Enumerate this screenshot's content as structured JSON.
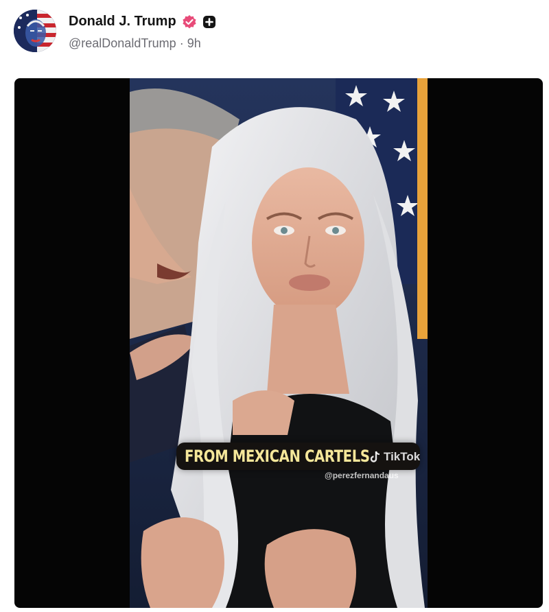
{
  "post": {
    "author_name": "Donald J. Trump",
    "handle": "@realDonaldTrump",
    "separator": "·",
    "time_ago": "9h"
  },
  "media": {
    "caption": "FROM MEXICAN CARTELS",
    "watermark_brand": "TikTok",
    "watermark_handle": "@perezfernandaus"
  },
  "colors": {
    "verified_badge": "#e84b79",
    "caption_text": "#f5e79a",
    "flag_pole": "#e8a23a",
    "backdrop": "#1e2d52"
  },
  "icons": {
    "verified": "verified-badge-icon",
    "plus": "plus-badge-icon"
  }
}
